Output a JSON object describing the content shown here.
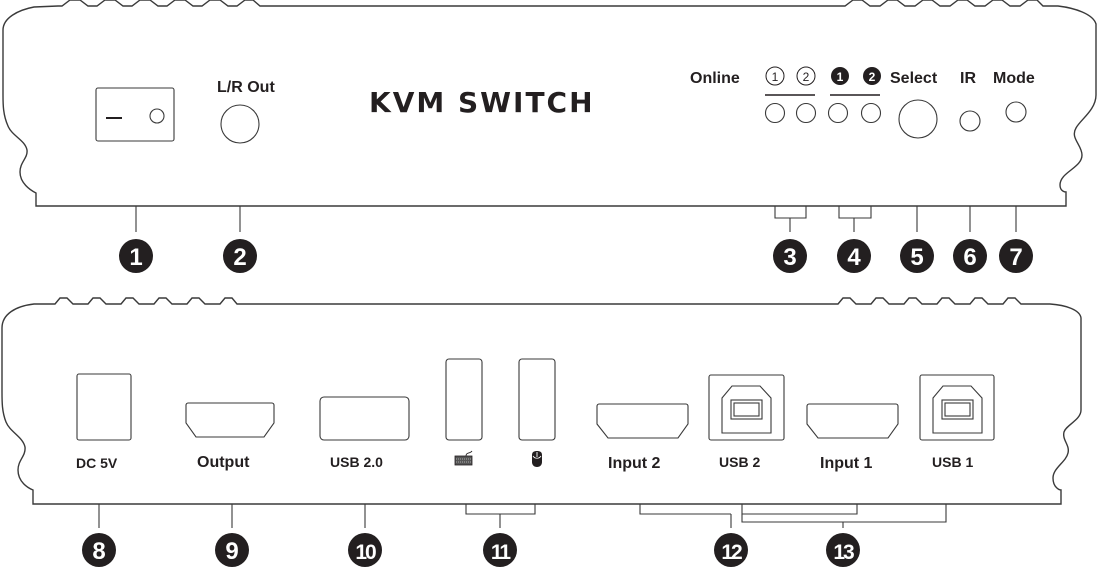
{
  "front_panel": {
    "title": "KVM SWITCH",
    "lr_out_label": "L/R Out",
    "online_label": "Online",
    "online_ports": [
      "①",
      "②"
    ],
    "selected_ports": [
      "1",
      "2"
    ],
    "select_label": "Select",
    "ir_label": "IR",
    "mode_label": "Mode",
    "power_switch_symbol": "—"
  },
  "rear_panel": {
    "dc_label": "DC 5V",
    "output_label": "Output",
    "usb20_label": "USB 2.0",
    "keyboard_icon": "keyboard-icon",
    "mouse_icon": "mouse-icon",
    "input2_label": "Input 2",
    "usb2_label": "USB 2",
    "input1_label": "Input 1",
    "usb1_label": "USB 1"
  },
  "callouts": {
    "front": [
      "1",
      "2",
      "3",
      "4",
      "5",
      "6",
      "7"
    ],
    "rear": [
      "8",
      "9",
      "10",
      "11",
      "12",
      "13"
    ]
  },
  "colors": {
    "ink": "#231f20",
    "outline": "#3a3a3a",
    "background": "#ffffff"
  }
}
